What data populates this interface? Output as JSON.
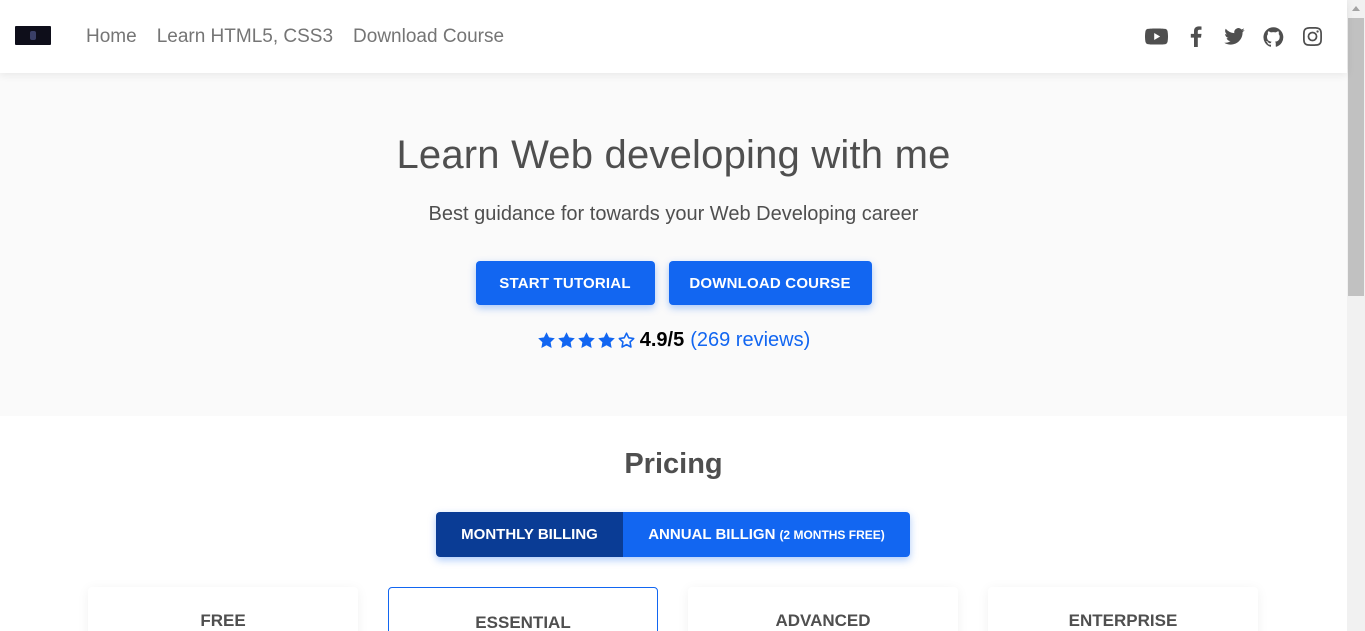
{
  "nav": {
    "links": [
      {
        "label": "Home"
      },
      {
        "label": "Learn HTML5, CSS3"
      },
      {
        "label": "Download Course"
      }
    ],
    "social_icons": [
      "youtube-icon",
      "facebook-icon",
      "twitter-icon",
      "github-icon",
      "instagram-icon"
    ]
  },
  "hero": {
    "title": "Learn Web developing with me",
    "subtitle": "Best guidance for towards your Web Developing career",
    "start_button": "START TUTORIAL",
    "download_button": "DOWNLOAD COURSE",
    "rating": {
      "stars_filled": 4,
      "stars_total": 5,
      "score": "4.9/5",
      "reviews": "(269 reviews)"
    }
  },
  "pricing": {
    "title": "Pricing",
    "monthly_label": "MONTHLY BILLING",
    "annual_label": "ANNUAL BILLIGN",
    "annual_note": "(2 MONTHS FREE)",
    "plans": [
      {
        "name": "FREE"
      },
      {
        "name": "ESSENTIAL"
      },
      {
        "name": "ADVANCED"
      },
      {
        "name": "ENTERPRISE"
      }
    ]
  },
  "colors": {
    "primary": "#1266f1",
    "primary_dark": "#0a3c95",
    "text": "#4f4f4f",
    "hero_bg": "#fafafa"
  }
}
